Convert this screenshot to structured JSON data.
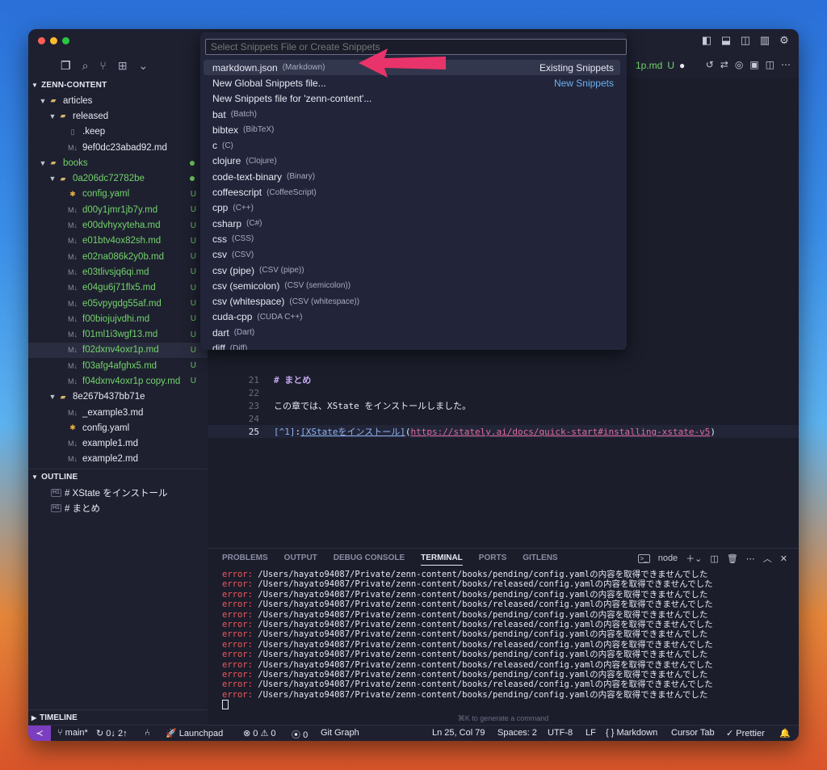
{
  "window": {
    "title": "zenn-content"
  },
  "activity_icons": [
    "files-icon",
    "search-icon",
    "source-control-icon",
    "extensions-icon",
    "chevron-down-icon"
  ],
  "explorer": {
    "root": "ZENN-CONTENT",
    "items": [
      {
        "label": "articles",
        "type": "folder",
        "depth": 1
      },
      {
        "label": "released",
        "type": "folder",
        "depth": 2
      },
      {
        "label": ".keep",
        "type": "file",
        "depth": 3
      },
      {
        "label": "9ef0dc23abad92.md",
        "type": "md",
        "depth": 3
      },
      {
        "label": "books",
        "type": "folder",
        "depth": 1,
        "green": true,
        "dot": true
      },
      {
        "label": "0a206dc72782be",
        "type": "folder",
        "depth": 2,
        "green": true,
        "dot": true
      },
      {
        "label": "config.yaml",
        "type": "yaml",
        "depth": 3,
        "green": true,
        "badge": "U"
      },
      {
        "label": "d00y1jmr1jb7y.md",
        "type": "md",
        "depth": 3,
        "green": true,
        "badge": "U"
      },
      {
        "label": "e00dvhyxyteha.md",
        "type": "md",
        "depth": 3,
        "green": true,
        "badge": "U"
      },
      {
        "label": "e01btv4ox82sh.md",
        "type": "md",
        "depth": 3,
        "green": true,
        "badge": "U"
      },
      {
        "label": "e02na086k2y0b.md",
        "type": "md",
        "depth": 3,
        "green": true,
        "badge": "U"
      },
      {
        "label": "e03tlivsjq6qi.md",
        "type": "md",
        "depth": 3,
        "green": true,
        "badge": "U"
      },
      {
        "label": "e04gu6j71flx5.md",
        "type": "md",
        "depth": 3,
        "green": true,
        "badge": "U"
      },
      {
        "label": "e05vpygdg55af.md",
        "type": "md",
        "depth": 3,
        "green": true,
        "badge": "U"
      },
      {
        "label": "f00biojujvdhi.md",
        "type": "md",
        "depth": 3,
        "green": true,
        "badge": "U"
      },
      {
        "label": "f01ml1i3wgf13.md",
        "type": "md",
        "depth": 3,
        "green": true,
        "badge": "U"
      },
      {
        "label": "f02dxnv4oxr1p.md",
        "type": "md",
        "depth": 3,
        "green": true,
        "badge": "U",
        "selected": true
      },
      {
        "label": "f03afg4afghx5.md",
        "type": "md",
        "depth": 3,
        "green": true,
        "badge": "U"
      },
      {
        "label": "f04dxnv4oxr1p copy.md",
        "type": "md",
        "depth": 3,
        "green": true,
        "badge": "U"
      },
      {
        "label": "8e267b437bb71e",
        "type": "folder",
        "depth": 2
      },
      {
        "label": "_example3.md",
        "type": "md",
        "depth": 3
      },
      {
        "label": "config.yaml",
        "type": "yaml",
        "depth": 3
      },
      {
        "label": "example1.md",
        "type": "md",
        "depth": 3
      },
      {
        "label": "example2.md",
        "type": "md",
        "depth": 3
      }
    ]
  },
  "outline": {
    "title": "OUTLINE",
    "items": [
      "# XState をインストール",
      "# まとめ"
    ]
  },
  "timeline": {
    "title": "TIMELINE"
  },
  "editor_tab": {
    "label": "1p.md",
    "badge": "U"
  },
  "code": [
    {
      "n": "21",
      "text": "# まとめ",
      "type": "heading"
    },
    {
      "n": "22",
      "text": "",
      "type": "plain"
    },
    {
      "n": "23",
      "text": "この章では、XState をインストールしました。",
      "type": "plain"
    },
    {
      "n": "24",
      "text": "",
      "type": "plain"
    },
    {
      "n": "25",
      "text": "",
      "type": "link",
      "current": true,
      "parts": {
        "ref": "[^1]",
        "colon": ":",
        "link_text": "[XStateをインストール]",
        "open": "(",
        "url": "https://stately.ai/docs/quick-start#installing-xstate-v5",
        "close": ")"
      }
    }
  ],
  "quick_pick": {
    "placeholder": "Select Snippets File or Create Snippets",
    "items": [
      {
        "label": "markdown.json",
        "desc": "(Markdown)",
        "sep": "Existing Snippets",
        "highlighted": true
      },
      {
        "label": "New Global Snippets file...",
        "desc": "",
        "sep": "New Snippets"
      },
      {
        "label": "New Snippets file for 'zenn-content'...",
        "desc": ""
      },
      {
        "label": "bat",
        "desc": "(Batch)"
      },
      {
        "label": "bibtex",
        "desc": "(BibTeX)"
      },
      {
        "label": "c",
        "desc": "(C)"
      },
      {
        "label": "clojure",
        "desc": "(Clojure)"
      },
      {
        "label": "code-text-binary",
        "desc": "(Binary)"
      },
      {
        "label": "coffeescript",
        "desc": "(CoffeeScript)"
      },
      {
        "label": "cpp",
        "desc": "(C++)"
      },
      {
        "label": "csharp",
        "desc": "(C#)"
      },
      {
        "label": "css",
        "desc": "(CSS)"
      },
      {
        "label": "csv",
        "desc": "(CSV)"
      },
      {
        "label": "csv (pipe)",
        "desc": "(CSV (pipe))"
      },
      {
        "label": "csv (semicolon)",
        "desc": "(CSV (semicolon))"
      },
      {
        "label": "csv (whitespace)",
        "desc": "(CSV (whitespace))"
      },
      {
        "label": "cuda-cpp",
        "desc": "(CUDA C++)"
      },
      {
        "label": "dart",
        "desc": "(Dart)"
      },
      {
        "label": "diff",
        "desc": "(Diff)"
      }
    ]
  },
  "panel": {
    "tabs": [
      "PROBLEMS",
      "OUTPUT",
      "DEBUG CONSOLE",
      "TERMINAL",
      "PORTS",
      "GITLENS"
    ],
    "active_tab": "TERMINAL",
    "shell": "node",
    "lines": [
      {
        "prefix": "error:",
        "text": " /Users/hayato94087/Private/zenn-content/books/pending/config.yamlの内容を取得できませんでした"
      },
      {
        "prefix": "error:",
        "text": " /Users/hayato94087/Private/zenn-content/books/released/config.yamlの内容を取得できませんでした"
      },
      {
        "prefix": "error:",
        "text": " /Users/hayato94087/Private/zenn-content/books/pending/config.yamlの内容を取得できませんでした"
      },
      {
        "prefix": "error:",
        "text": " /Users/hayato94087/Private/zenn-content/books/released/config.yamlの内容を取得できませんでした"
      },
      {
        "prefix": "error:",
        "text": " /Users/hayato94087/Private/zenn-content/books/pending/config.yamlの内容を取得できませんでした"
      },
      {
        "prefix": "error:",
        "text": " /Users/hayato94087/Private/zenn-content/books/released/config.yamlの内容を取得できませんでした"
      },
      {
        "prefix": "error:",
        "text": " /Users/hayato94087/Private/zenn-content/books/pending/config.yamlの内容を取得できませんでした"
      },
      {
        "prefix": "error:",
        "text": " /Users/hayato94087/Private/zenn-content/books/released/config.yamlの内容を取得できませんでした"
      },
      {
        "prefix": "error:",
        "text": " /Users/hayato94087/Private/zenn-content/books/pending/config.yamlの内容を取得できませんでした"
      },
      {
        "prefix": "error:",
        "text": " /Users/hayato94087/Private/zenn-content/books/released/config.yamlの内容を取得できませんでした"
      },
      {
        "prefix": "error:",
        "text": " /Users/hayato94087/Private/zenn-content/books/pending/config.yamlの内容を取得できませんでした"
      },
      {
        "prefix": "error:",
        "text": " /Users/hayato94087/Private/zenn-content/books/released/config.yamlの内容を取得できませんでした"
      },
      {
        "prefix": "error:",
        "text": " /Users/hayato94087/Private/zenn-content/books/pending/config.yamlの内容を取得できませんでした"
      }
    ],
    "hint": "⌘K to generate a command"
  },
  "status": {
    "branch": "main*",
    "sync": "0↓ 2↑",
    "launchpad": "Launchpad",
    "problems": "0",
    "warnings": "0",
    "ports": "0",
    "git_graph": "Git Graph",
    "position": "Ln 25, Col 79",
    "spaces": "Spaces: 2",
    "encoding": "UTF-8",
    "eol": "LF",
    "language": "Markdown",
    "cursor_tab": "Cursor Tab",
    "prettier": "Prettier"
  },
  "colors": {
    "accent": "#7c3ec0",
    "git_added": "#73d36a",
    "error": "#f0585a",
    "arrow": "#e8346a"
  }
}
